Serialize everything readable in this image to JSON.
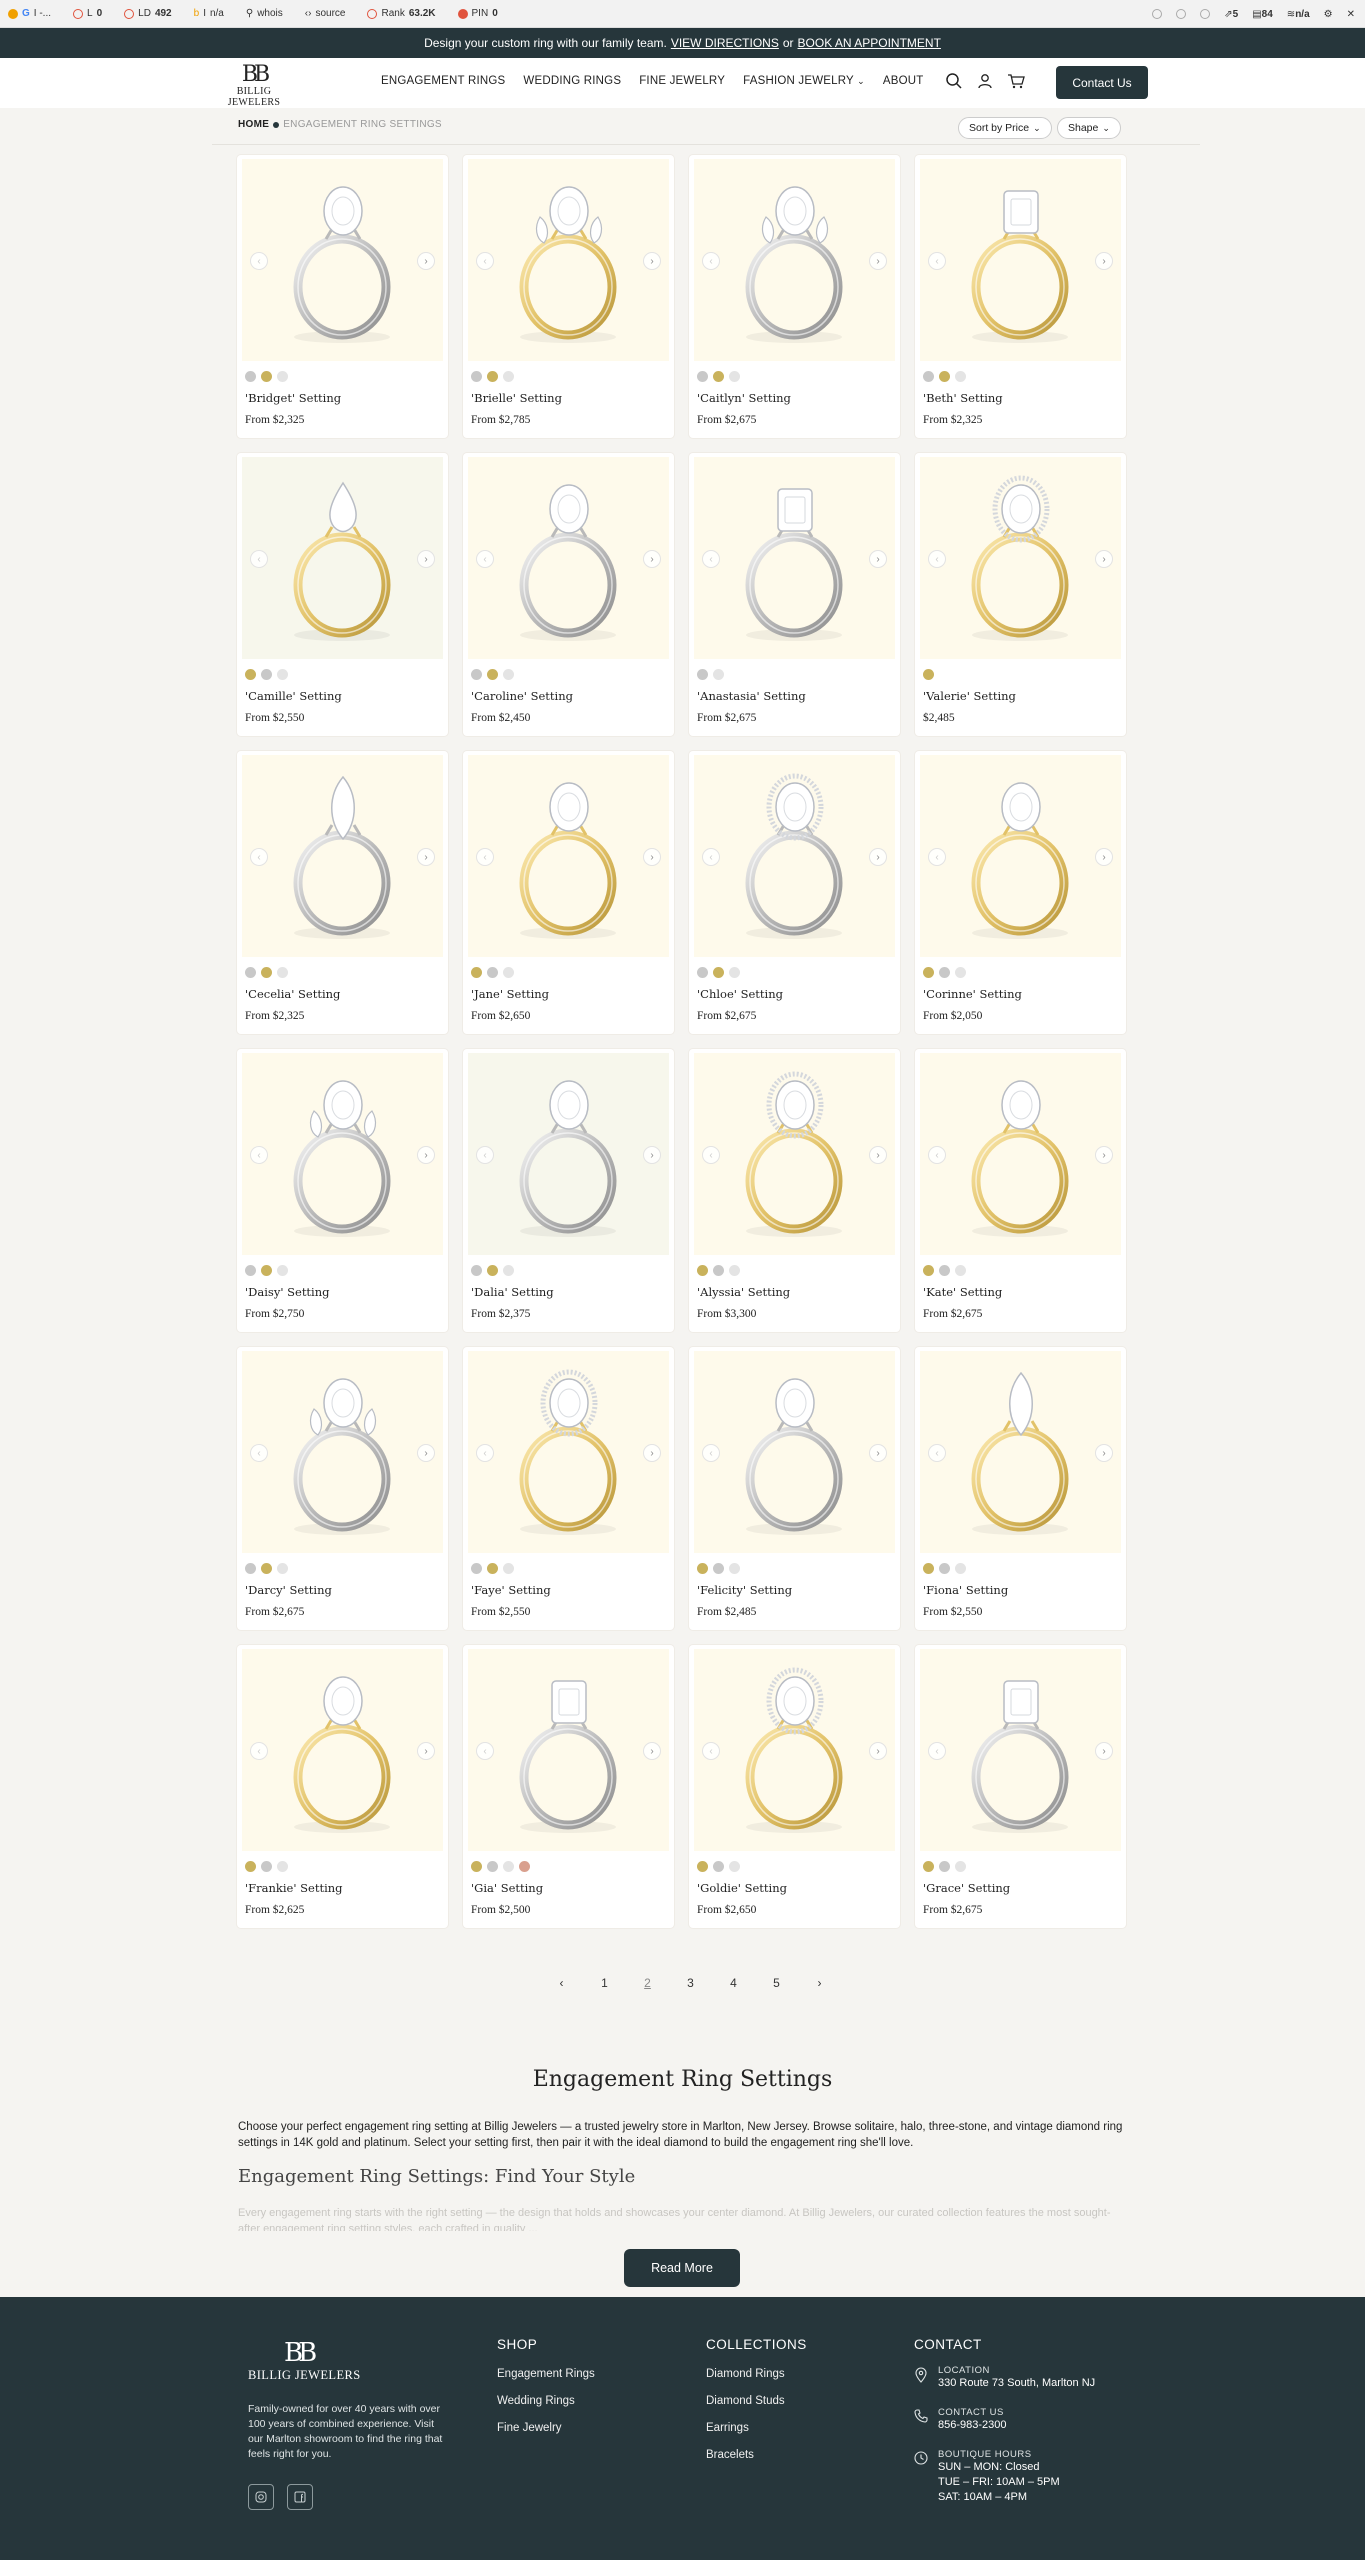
{
  "toolbar": {
    "items": [
      {
        "label": "I -...",
        "value": ""
      },
      {
        "label": "L",
        "value": "0"
      },
      {
        "label": "LD",
        "value": "492"
      },
      {
        "label": "I",
        "value": "n/a"
      },
      {
        "label": "whois",
        "value": ""
      },
      {
        "label": "source",
        "value": ""
      },
      {
        "label": "Rank",
        "value": "63.2K"
      },
      {
        "label": "PIN",
        "value": "0"
      }
    ],
    "right": [
      {
        "label": "",
        "value": "5"
      },
      {
        "label": "",
        "value": "84"
      },
      {
        "label": "",
        "value": "n/a"
      }
    ]
  },
  "announcement": {
    "text": "Design your custom ring with our family team.",
    "link1": "VIEW DIRECTIONS",
    "or": "or",
    "link2": "BOOK AN APPOINTMENT"
  },
  "header": {
    "logo_mono": "BB",
    "logo_word": "BILLIG JEWELERS",
    "nav": [
      "ENGAGEMENT RINGS",
      "WEDDING RINGS",
      "FINE JEWELRY",
      "FASHION JEWELRY",
      "ABOUT"
    ],
    "contact_label": "Contact Us"
  },
  "breadcrumb": {
    "home": "HOME",
    "current": "ENGAGEMENT RING SETTINGS"
  },
  "filters": {
    "sort_label": "Sort by Price",
    "shape_label": "Shape"
  },
  "colors": {
    "dark": "#26363b",
    "white_gold": "#c8c8c8",
    "yellow_gold": "#c9b25c",
    "platinum": "#e4e4e4",
    "rose_gold": "#d9a08e"
  },
  "products": [
    {
      "name": "'Bridget' Setting",
      "price": "From $2,325",
      "metal": "white",
      "stone": "oval",
      "swatches": [
        "white_gold",
        "yellow_gold",
        "platinum"
      ]
    },
    {
      "name": "'Brielle' Setting",
      "price": "From $2,785",
      "metal": "yellow",
      "stone": "three",
      "swatches": [
        "white_gold",
        "yellow_gold",
        "platinum"
      ]
    },
    {
      "name": "'Caitlyn' Setting",
      "price": "From $2,675",
      "metal": "white",
      "stone": "three",
      "swatches": [
        "white_gold",
        "yellow_gold",
        "platinum"
      ]
    },
    {
      "name": "'Beth' Setting",
      "price": "From $2,325",
      "metal": "yellow",
      "stone": "emerald",
      "swatches": [
        "white_gold",
        "yellow_gold",
        "platinum"
      ]
    },
    {
      "name": "'Camille' Setting",
      "price": "From $2,550",
      "metal": "yellow",
      "stone": "pear",
      "swatches": [
        "yellow_gold",
        "white_gold",
        "platinum"
      ],
      "alt": true
    },
    {
      "name": "'Caroline' Setting",
      "price": "From $2,450",
      "metal": "white",
      "stone": "oval",
      "swatches": [
        "white_gold",
        "yellow_gold",
        "platinum"
      ]
    },
    {
      "name": "'Anastasia' Setting",
      "price": "From $2,675",
      "metal": "white",
      "stone": "radiant",
      "swatches": [
        "white_gold",
        "platinum"
      ]
    },
    {
      "name": "'Valerie' Setting",
      "price": "$2,485",
      "metal": "yellow",
      "stone": "halo",
      "swatches": [
        "yellow_gold"
      ]
    },
    {
      "name": "'Cecelia' Setting",
      "price": "From $2,325",
      "metal": "white",
      "stone": "marquise",
      "swatches": [
        "white_gold",
        "yellow_gold",
        "platinum"
      ]
    },
    {
      "name": "'Jane' Setting",
      "price": "From $2,650",
      "metal": "yellow",
      "stone": "oval",
      "swatches": [
        "yellow_gold",
        "white_gold",
        "platinum"
      ]
    },
    {
      "name": "'Chloe' Setting",
      "price": "From $2,675",
      "metal": "white",
      "stone": "halo",
      "swatches": [
        "white_gold",
        "yellow_gold",
        "platinum"
      ]
    },
    {
      "name": "'Corinne' Setting",
      "price": "From $2,050",
      "metal": "yellow",
      "stone": "oval",
      "swatches": [
        "yellow_gold",
        "white_gold",
        "platinum"
      ]
    },
    {
      "name": "'Daisy' Setting",
      "price": "From $2,750",
      "metal": "white",
      "stone": "three",
      "swatches": [
        "white_gold",
        "yellow_gold",
        "platinum"
      ]
    },
    {
      "name": "'Dalia' Setting",
      "price": "From $2,375",
      "metal": "white",
      "stone": "oval",
      "swatches": [
        "white_gold",
        "yellow_gold",
        "platinum"
      ],
      "alt": true
    },
    {
      "name": "'Alyssia' Setting",
      "price": "From $3,300",
      "metal": "yellow",
      "stone": "halo",
      "swatches": [
        "yellow_gold",
        "white_gold",
        "platinum"
      ]
    },
    {
      "name": "'Kate' Setting",
      "price": "From $2,675",
      "metal": "yellow",
      "stone": "oval",
      "swatches": [
        "yellow_gold",
        "white_gold",
        "platinum"
      ]
    },
    {
      "name": "'Darcy' Setting",
      "price": "From $2,675",
      "metal": "white",
      "stone": "three",
      "swatches": [
        "white_gold",
        "yellow_gold",
        "platinum"
      ]
    },
    {
      "name": "'Faye' Setting",
      "price": "From $2,550",
      "metal": "yellow",
      "stone": "halo",
      "swatches": [
        "white_gold",
        "yellow_gold",
        "platinum"
      ]
    },
    {
      "name": "'Felicity' Setting",
      "price": "From $2,485",
      "metal": "white",
      "stone": "oval",
      "swatches": [
        "yellow_gold",
        "white_gold",
        "platinum"
      ]
    },
    {
      "name": "'Fiona' Setting",
      "price": "From $2,550",
      "metal": "yellow",
      "stone": "marquise",
      "swatches": [
        "yellow_gold",
        "white_gold",
        "platinum"
      ]
    },
    {
      "name": "'Frankie' Setting",
      "price": "From $2,625",
      "metal": "yellow",
      "stone": "oval",
      "swatches": [
        "yellow_gold",
        "white_gold",
        "platinum"
      ]
    },
    {
      "name": "'Gia' Setting",
      "price": "From $2,500",
      "metal": "white",
      "stone": "emerald",
      "swatches": [
        "yellow_gold",
        "white_gold",
        "platinum",
        "rose_gold"
      ]
    },
    {
      "name": "'Goldie' Setting",
      "price": "From $2,650",
      "metal": "yellow",
      "stone": "halo",
      "swatches": [
        "yellow_gold",
        "white_gold",
        "platinum"
      ]
    },
    {
      "name": "'Grace' Setting",
      "price": "From $2,675",
      "metal": "white",
      "stone": "emerald",
      "swatches": [
        "yellow_gold",
        "white_gold",
        "platinum"
      ]
    }
  ],
  "pagination": {
    "prev": "‹",
    "pages": [
      "1",
      "2",
      "3",
      "4",
      "5"
    ],
    "current": "2",
    "next": "›"
  },
  "seo": {
    "title": "Engagement Ring Settings",
    "intro": "Choose your perfect engagement ring setting at Billig Jewelers — a trusted jewelry store in Marlton, New Jersey. Browse solitaire, halo, three-stone, and vintage diamond ring settings in 14K gold and platinum. Select your setting first, then pair it with the ideal diamond to build the engagement ring she'll love.",
    "h2": "Engagement Ring Settings: Find Your Style",
    "faded": "Every engagement ring starts with the right setting — the design that holds and showcases your center diamond. At Billig Jewelers, our curated collection features the most sought-after engagement ring setting styles, each crafted in quality ...",
    "read_more": "Read More"
  },
  "footer": {
    "logo_mono": "BB",
    "logo_word": "BILLIG JEWELERS",
    "description": "Family-owned for over 40 years with over 100 years of combined experience. Visit our Marlton showroom to find the ring that feels right for you.",
    "shop": {
      "title": "SHOP",
      "links": [
        "Engagement Rings",
        "Wedding Rings",
        "Fine Jewelry"
      ]
    },
    "collections": {
      "title": "COLLECTIONS",
      "links": [
        "Diamond Rings",
        "Diamond Studs",
        "Earrings",
        "Bracelets"
      ]
    },
    "contact": {
      "title": "CONTACT",
      "location_label": "LOCATION",
      "location": "330 Route 73 South, Marlton NJ",
      "phone_label": "CONTACT US",
      "phone": "856-983-2300",
      "hours_label": "BOUTIQUE HOURS",
      "hours": [
        "SUN – MON: Closed",
        "TUE – FRI: 10AM – 5PM",
        "SAT: 10AM – 4PM"
      ]
    }
  }
}
